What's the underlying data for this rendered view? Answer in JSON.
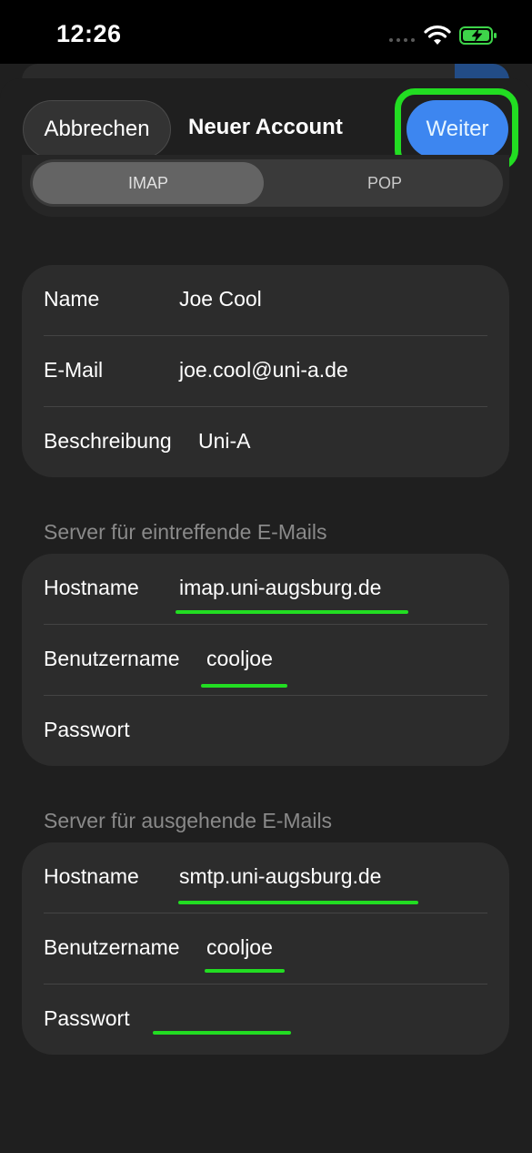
{
  "status_bar": {
    "time": "12:26"
  },
  "nav": {
    "cancel_label": "Abbrechen",
    "title": "Neuer Account",
    "next_label": "Weiter"
  },
  "segmented": {
    "options": [
      "IMAP",
      "POP"
    ],
    "selected": "IMAP"
  },
  "account": {
    "name_label": "Name",
    "name_value": "Joe Cool",
    "email_label": "E-Mail",
    "email_value": "joe.cool@uni-a.de",
    "description_label": "Beschreibung",
    "description_value": "Uni-A"
  },
  "incoming": {
    "header": "Server für eintreffende E-Mails",
    "hostname_label": "Hostname",
    "hostname_value": "imap.uni-augsburg.de",
    "username_label": "Benutzername",
    "username_value": "cooljoe",
    "password_label": "Passwort",
    "password_value": ""
  },
  "outgoing": {
    "header": "Server für ausgehende E-Mails",
    "hostname_label": "Hostname",
    "hostname_value": "smtp.uni-augsburg.de",
    "username_label": "Benutzername",
    "username_value": "cooljoe",
    "password_label": "Passwort",
    "password_value": ""
  },
  "colors": {
    "highlight": "#22dd22",
    "accent_button": "#3d86f0",
    "background": "#1f1f1f",
    "group_background": "#2c2c2c"
  }
}
